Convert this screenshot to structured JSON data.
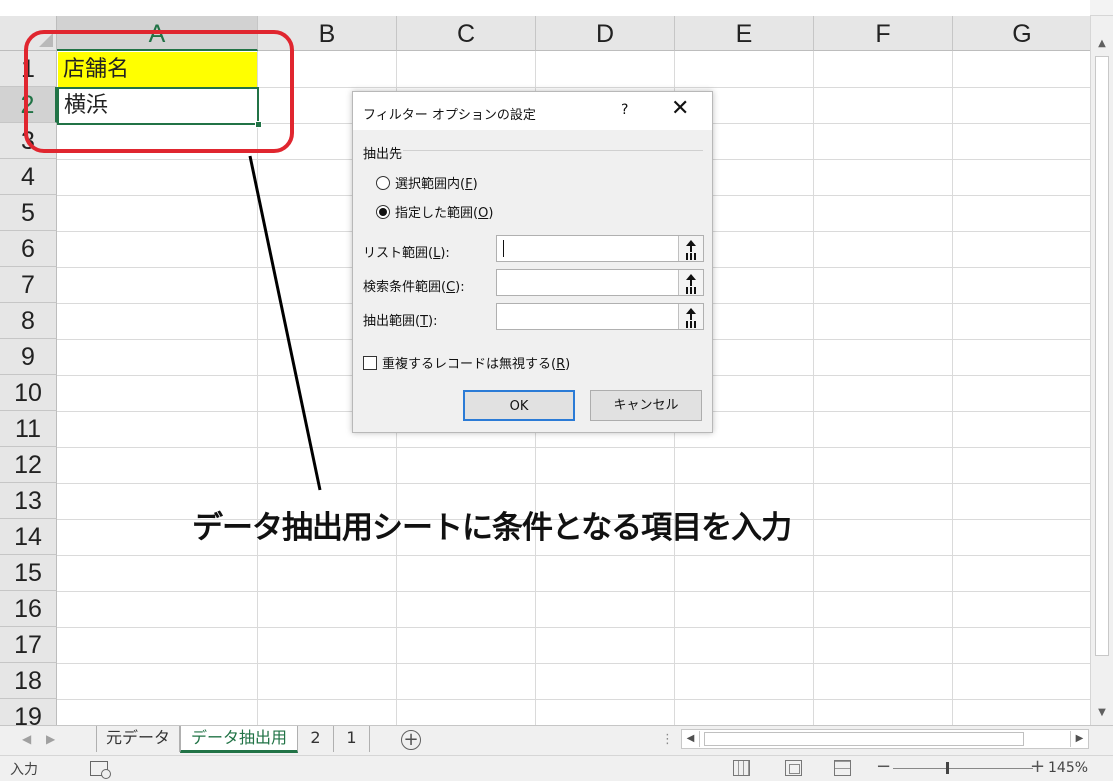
{
  "sheet": {
    "columns": [
      "A",
      "B",
      "C",
      "D",
      "E",
      "F",
      "G"
    ],
    "rows": [
      "1",
      "2",
      "3",
      "4",
      "5",
      "6",
      "7",
      "8",
      "9",
      "10",
      "11",
      "12",
      "13",
      "14",
      "15",
      "16",
      "17",
      "18",
      "19"
    ],
    "cells": {
      "A1": "店舗名",
      "A2": "横浜"
    }
  },
  "annotation": {
    "text": "データ抽出用シートに条件となる項目を入力",
    "highlight_color": "#e0262f"
  },
  "dialog": {
    "title": "フィルター オプションの設定",
    "help": "?",
    "close": "✕",
    "group_label": "抽出先",
    "radio1": {
      "label": "選択範囲内(",
      "key": "F",
      "tail": ")",
      "selected": false
    },
    "radio2": {
      "label": "指定した範囲(",
      "key": "O",
      "tail": ")",
      "selected": true
    },
    "list_range": {
      "label": "リスト範囲(",
      "key": "L",
      "tail": "):",
      "value": ""
    },
    "criteria_range": {
      "label": "検索条件範囲(",
      "key": "C",
      "tail": "):",
      "value": ""
    },
    "extract_range": {
      "label": "抽出範囲(",
      "key": "T",
      "tail": "):",
      "value": ""
    },
    "unique": {
      "label": "重複するレコードは無視する(",
      "key": "R",
      "tail": ")",
      "checked": false
    },
    "ok": "OK",
    "cancel": "キャンセル"
  },
  "tabs": {
    "items": [
      "元データ",
      "データ抽出用",
      "2",
      "1"
    ],
    "active": "データ抽出用",
    "add": "+"
  },
  "status": {
    "mode": "入力",
    "zoom": "145%",
    "zoom_minus": "−",
    "zoom_plus": "+"
  },
  "colors": {
    "accent": "#217346",
    "highlight_fill": "#ffff00",
    "ok_border": "#2b7bd6"
  }
}
